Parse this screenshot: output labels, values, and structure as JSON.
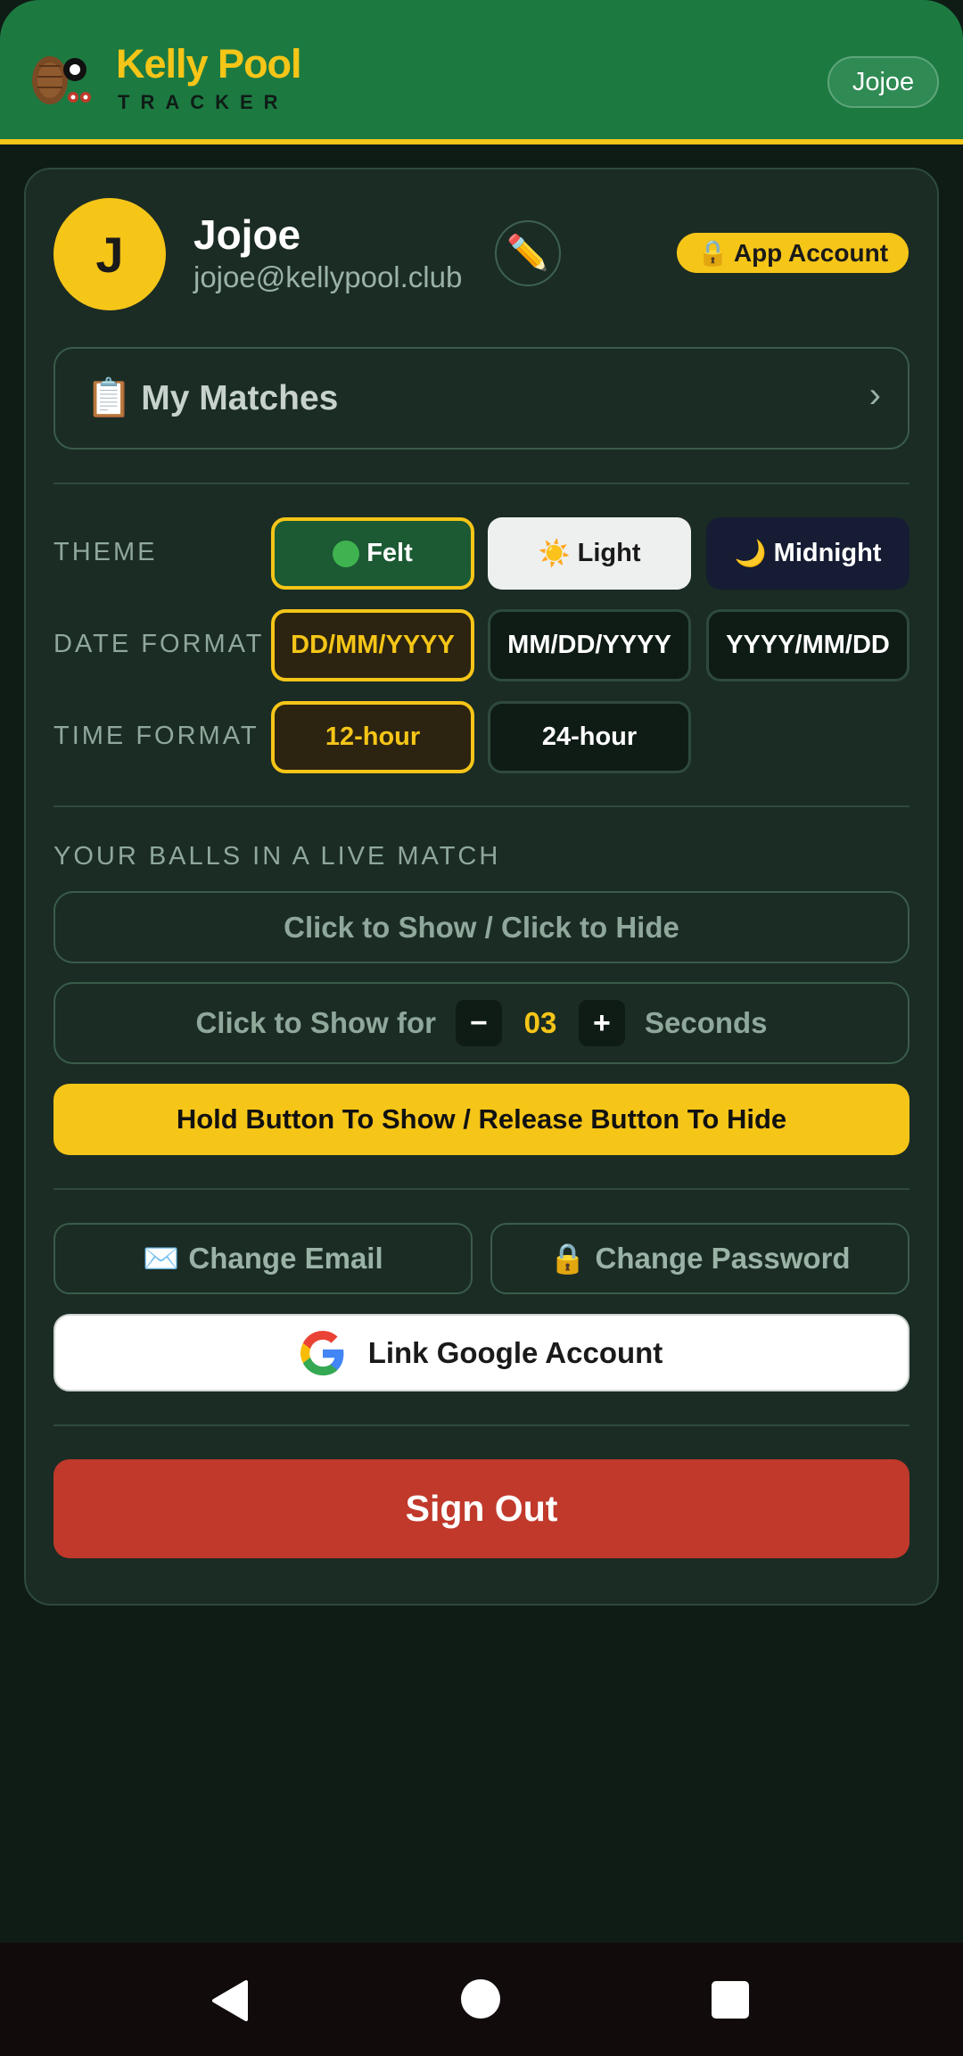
{
  "header": {
    "brand_title": "Kelly Pool",
    "brand_subtitle": "TRACKER",
    "user_pill": "Jojoe"
  },
  "profile": {
    "avatar_initial": "J",
    "name": "Jojoe",
    "email": "jojoe@kellypool.club",
    "edit_icon": "✏️",
    "badge_icon": "🔒",
    "badge_label": "App Account"
  },
  "matches": {
    "icon": "📋",
    "label": "My Matches",
    "chevron": "›"
  },
  "settings": {
    "theme": {
      "label": "THEME",
      "options": [
        {
          "label": "Felt",
          "icon": "green-circle-icon",
          "selected": true
        },
        {
          "label": "Light",
          "icon": "☀️",
          "selected": false
        },
        {
          "label": "Midnight",
          "icon": "🌙",
          "selected": false
        }
      ]
    },
    "date_format": {
      "label": "DATE FORMAT",
      "options": [
        {
          "label": "DD/MM/YYYY",
          "selected": true
        },
        {
          "label": "MM/DD/YYYY",
          "selected": false
        },
        {
          "label": "YYYY/MM/DD",
          "selected": false
        }
      ]
    },
    "time_format": {
      "label": "TIME FORMAT",
      "options": [
        {
          "label": "12-hour",
          "selected": true
        },
        {
          "label": "24-hour",
          "selected": false
        }
      ]
    }
  },
  "balls": {
    "section_label": "YOUR BALLS IN A LIVE MATCH",
    "toggle_label": "Click to Show / Click to Hide",
    "timed_prefix": "Click to Show for",
    "minus": "−",
    "seconds_value": "03",
    "plus": "+",
    "timed_suffix": "Seconds",
    "hold_label": "Hold Button To Show / Release Button To Hide"
  },
  "account": {
    "change_email_icon": "✉️",
    "change_email": "Change Email",
    "change_password_icon": "🔒",
    "change_password": "Change Password",
    "link_google": "Link Google Account",
    "sign_out": "Sign Out"
  },
  "colors": {
    "accent": "#f5c518",
    "header_green": "#1c7a41",
    "card_bg": "#1b2c24",
    "page_bg": "#0f1c16",
    "danger": "#c0392b"
  }
}
